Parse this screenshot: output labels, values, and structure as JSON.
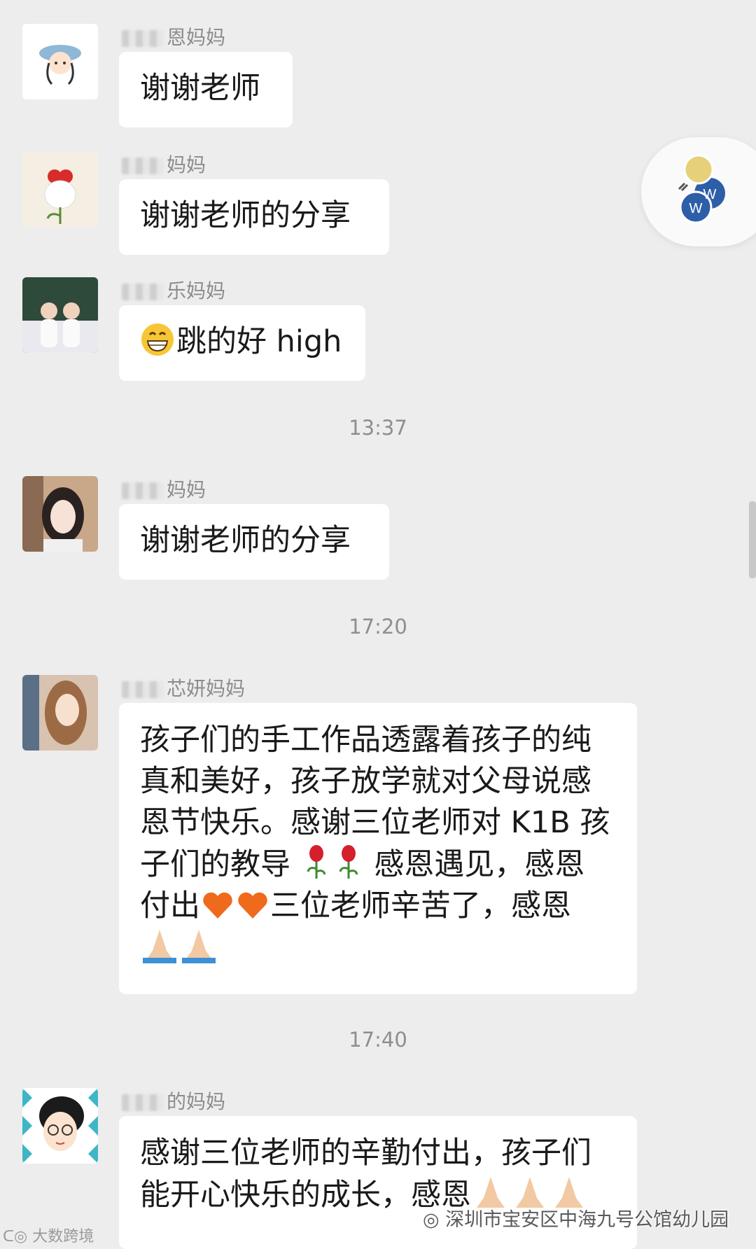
{
  "messages": [
    {
      "sender_suffix": "恩妈妈",
      "text": "谢谢老师"
    },
    {
      "sender_suffix": "妈妈",
      "text": "谢谢老师的分享"
    },
    {
      "sender_suffix": "乐妈妈",
      "text": "跳的好 high"
    },
    {
      "sender_suffix": "妈妈",
      "text": "谢谢老师的分享"
    },
    {
      "sender_suffix": "芯妍妈妈",
      "lines": [
        "孩子们的手工作品透露着孩子的纯",
        "真和美好，孩子放学就对父母说感",
        "恩节快乐。感谢三位老师对 K1B 孩",
        "子们的教导",
        "感恩遇见，感恩",
        "付出",
        "三位老师辛苦了，感恩"
      ]
    },
    {
      "sender_suffix": "的妈妈",
      "lines": [
        "感谢三位老师的辛勤付出，孩子们",
        "能开心快乐的成长，感恩"
      ]
    }
  ],
  "timestamps": [
    "13:37",
    "17:20",
    "17:40"
  ],
  "watermark": {
    "right": "深圳市宝安区中海九号公馆幼儿园",
    "left": "大数跨境"
  },
  "icons": {
    "grin": "grinning-face-emoji",
    "rose": "rose-emoji",
    "heart": "orange-heart-emoji",
    "pray": "folded-hands-emoji"
  },
  "colors": {
    "background": "#ededed",
    "bubble": "#ffffff",
    "meta_text": "#8c8c8c"
  }
}
